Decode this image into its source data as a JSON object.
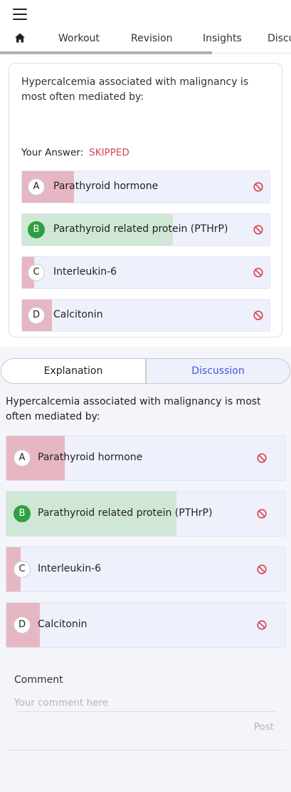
{
  "nav": {
    "tabs": [
      "Workout",
      "Revision",
      "Insights",
      "Discussion"
    ]
  },
  "question": {
    "text": "Hypercalcemia associated with malignancy is most often mediated by:",
    "your_answer_label": "Your Answer:",
    "your_answer_value": "SKIPPED"
  },
  "options": [
    {
      "letter": "A",
      "text": "Parathyroid hormone",
      "percent": 21,
      "correct": false
    },
    {
      "letter": "B",
      "text": "Parathyroid related protein (PTHrP)",
      "percent": 61,
      "correct": true
    },
    {
      "letter": "C",
      "text": "Interleukin-6",
      "percent": 5,
      "correct": false
    },
    {
      "letter": "D",
      "text": "Calcitonin",
      "percent": 12,
      "correct": false
    }
  ],
  "segmented": {
    "explanation": "Explanation",
    "discussion": "Discussion"
  },
  "discussion": {
    "question_text": "Hypercalcemia associated with malignancy is most often mediated by:"
  },
  "comment": {
    "label": "Comment",
    "placeholder": "Your comment here",
    "post_label": "Post"
  },
  "colors": {
    "wrong_fill": "#e6b7c3",
    "correct_fill": "#cfe8d6",
    "option_bg": "#eef0fc",
    "skipped": "#d9434e",
    "active_tab": "#3b5bd6",
    "correct_badge": "#2ea043"
  }
}
